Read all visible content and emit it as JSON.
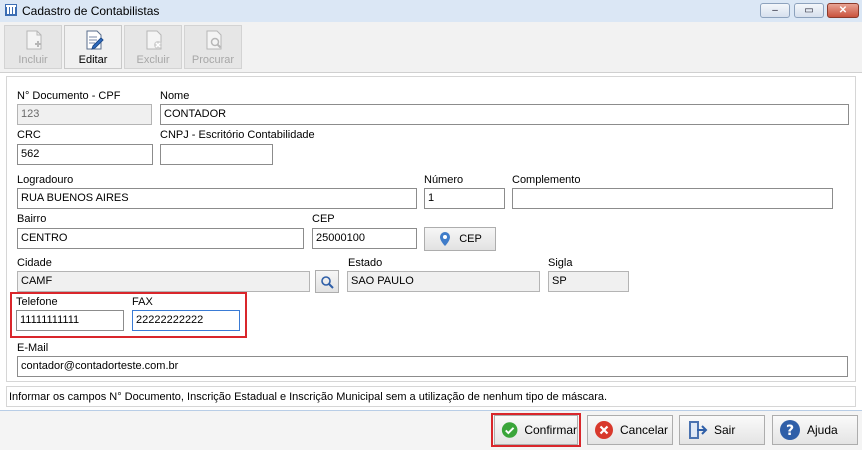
{
  "window": {
    "title": "Cadastro de Contabilistas",
    "minimize_glyph": "–",
    "maximize_glyph": "▭",
    "close_glyph": "✕"
  },
  "toolbar": {
    "incluir": "Incluir",
    "editar": "Editar",
    "excluir": "Excluir",
    "procurar": "Procurar"
  },
  "form": {
    "documento_label": "N° Documento - CPF",
    "documento_value": "123",
    "nome_label": "Nome",
    "nome_value": "CONTADOR",
    "crc_label": "CRC",
    "crc_value": "562",
    "cnpj_label": "CNPJ - Escritório Contabilidade",
    "cnpj_value": "",
    "logradouro_label": "Logradouro",
    "logradouro_value": "RUA BUENOS AIRES",
    "numero_label": "Número",
    "numero_value": "1",
    "complemento_label": "Complemento",
    "complemento_value": "",
    "bairro_label": "Bairro",
    "bairro_value": "CENTRO",
    "cep_label": "CEP",
    "cep_value": "25000100",
    "cep_button": "CEP",
    "cidade_label": "Cidade",
    "cidade_value": "CAMF",
    "estado_label": "Estado",
    "estado_value": "SAO PAULO",
    "sigla_label": "Sigla",
    "sigla_value": "SP",
    "telefone_label": "Telefone",
    "telefone_value": "11111111111",
    "fax_label": "FAX",
    "fax_value": "22222222222",
    "email_label": "E-Mail",
    "email_value": "contador@contadorteste.com.br"
  },
  "info_text": "Informar os campos N° Documento, Inscrição Estadual e Inscrição Municipal sem a utilização de nenhum tipo de máscara.",
  "footer": {
    "confirmar": "Confirmar",
    "cancelar": "Cancelar",
    "sair": "Sair",
    "ajuda": "Ajuda"
  },
  "colors": {
    "highlight_red": "#d9262b",
    "confirm_green": "#3aa53a",
    "cancel_red": "#d8392c",
    "help_blue": "#2f5fa8"
  }
}
